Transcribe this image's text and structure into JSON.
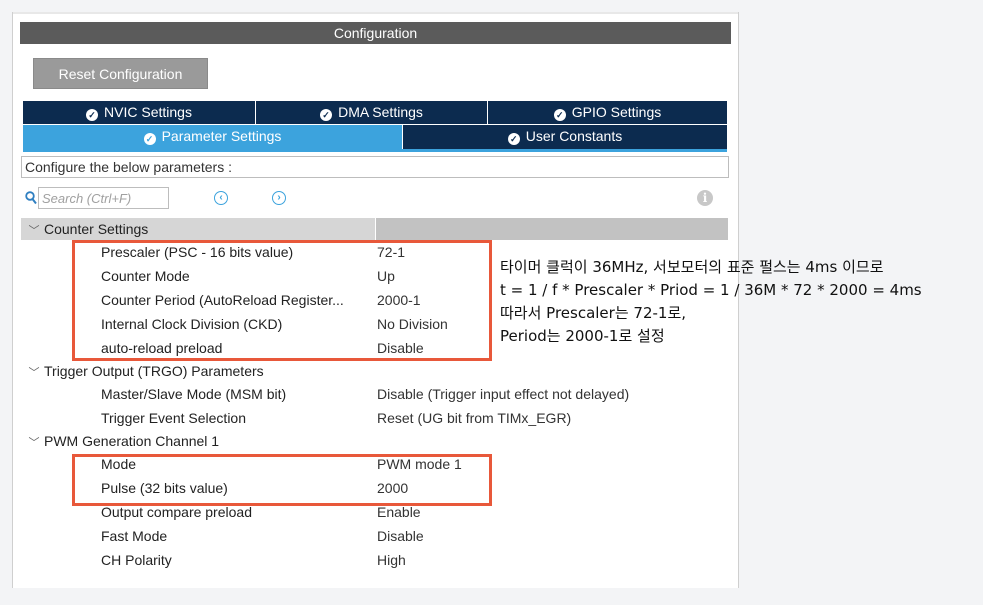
{
  "window": {
    "title": "Configuration"
  },
  "toolbar": {
    "reset_label": "Reset Configuration"
  },
  "tabs": {
    "row1": [
      {
        "label": "NVIC Settings"
      },
      {
        "label": "DMA Settings"
      },
      {
        "label": "GPIO Settings"
      }
    ],
    "row2": [
      {
        "label": "Parameter Settings",
        "active": true
      },
      {
        "label": "User Constants"
      }
    ]
  },
  "configure_text": "Configure the below parameters :",
  "search": {
    "placeholder": "Search (Ctrl+F)"
  },
  "groups": [
    {
      "name": "Counter Settings",
      "params": [
        {
          "name": "Prescaler (PSC - 16 bits value)",
          "value": "72-1"
        },
        {
          "name": "Counter Mode",
          "value": "Up"
        },
        {
          "name": "Counter Period (AutoReload Register...",
          "value": "2000-1"
        },
        {
          "name": "Internal Clock Division (CKD)",
          "value": "No Division"
        },
        {
          "name": "auto-reload preload",
          "value": "Disable"
        }
      ]
    },
    {
      "name": "Trigger Output (TRGO) Parameters",
      "params": [
        {
          "name": "Master/Slave Mode (MSM bit)",
          "value": "Disable (Trigger input effect not delayed)"
        },
        {
          "name": "Trigger Event Selection",
          "value": "Reset (UG bit from TIMx_EGR)"
        }
      ]
    },
    {
      "name": "PWM Generation Channel 1",
      "params": [
        {
          "name": "Mode",
          "value": "PWM mode 1"
        },
        {
          "name": "Pulse (32 bits value)",
          "value": "2000"
        },
        {
          "name": "Output compare preload",
          "value": "Enable"
        },
        {
          "name": "Fast Mode",
          "value": "Disable"
        },
        {
          "name": "CH Polarity",
          "value": "High"
        }
      ]
    }
  ],
  "annotation": {
    "lines": [
      "타이머 클럭이 36MHz, 서보모터의 표준 펄스는 4ms 이므로",
      "t = 1 / f * Prescaler * Priod = 1 / 36M * 72 * 2000 = 4ms",
      "따라서 Prescaler는 72-1로,",
      "Period는 2000-1로 설정"
    ]
  },
  "colors": {
    "accent": "#3ca3dd",
    "tab_dark": "#0c2b4f",
    "highlight": "#e8583a"
  }
}
